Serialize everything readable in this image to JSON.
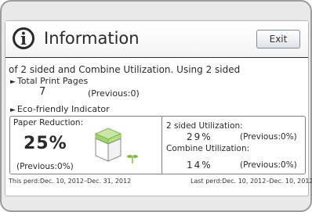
{
  "header": {
    "icon": "info-icon",
    "title": "Information",
    "exit_label": "Exit"
  },
  "description": "of 2 sided and Combine Utilization. Using 2 sided",
  "total_print_pages": {
    "label": "Total Print Pages",
    "value": "7",
    "previous": "(Previous:0)"
  },
  "eco": {
    "label": "Eco-friendly Indicator",
    "paper_reduction": {
      "label": "Paper Reduction:",
      "value": "25%",
      "previous": "(Previous:0%)"
    },
    "two_sided": {
      "label": "2 sided Utilization:",
      "value": "29%",
      "previous": "(Previous:0%)"
    },
    "combine": {
      "label": "Combine Utilization:",
      "value": "14%",
      "previous": "(Previous:0%)"
    }
  },
  "footer": {
    "this_period": "This perd:Dec. 10, 2012–Dec. 31, 2012",
    "last_period": "Last perd:Dec. 10, 2012–Dec. 10, 2012"
  },
  "colors": {
    "accent_green": "#7cbf3c",
    "button_border": "#7e8c9e",
    "background": "#e9e9e9"
  }
}
